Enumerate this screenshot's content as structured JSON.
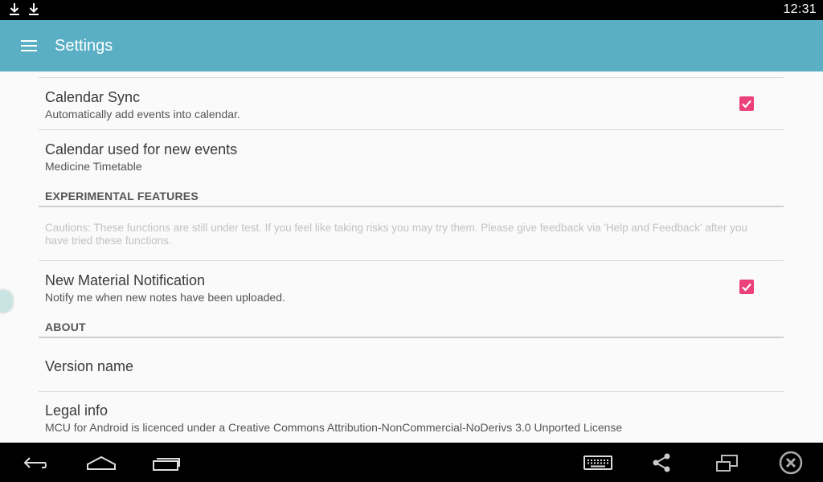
{
  "status_bar": {
    "time": "12:31",
    "notification_icons": [
      "download-icon",
      "download-icon"
    ]
  },
  "app_bar": {
    "title": "Settings",
    "menu_icon": "hamburger-menu-icon",
    "color": "#5bafc4"
  },
  "preferences": {
    "calendar_sync": {
      "title": "Calendar Sync",
      "summary": "Automatically add events into calendar.",
      "checked": true
    },
    "calendar_used": {
      "title": "Calendar used for new events",
      "summary": "Medicine Timetable"
    },
    "experimental_header": "EXPERIMENTAL FEATURES",
    "caution_text": "Cautions: These functions are still under test. If you feel like taking risks you may try them. Please give feedback via 'Help and Feedback' after you have tried these functions.",
    "new_material": {
      "title": "New Material Notification",
      "summary": "Notify me when new notes have been uploaded.",
      "checked": true
    },
    "about_header": "ABOUT",
    "version_name": {
      "title": "Version name"
    },
    "legal_info": {
      "title": "Legal info",
      "summary": "MCU for Android is licenced under a Creative Commons Attribution-NonCommercial-NoDerivs 3.0 Unported License"
    }
  },
  "checkbox_color": "#ec407a",
  "nav_bar": {
    "buttons": [
      "back-icon",
      "home-icon",
      "recent-apps-icon",
      "keyboard-icon",
      "share-icon",
      "window-icon",
      "close-icon"
    ]
  }
}
